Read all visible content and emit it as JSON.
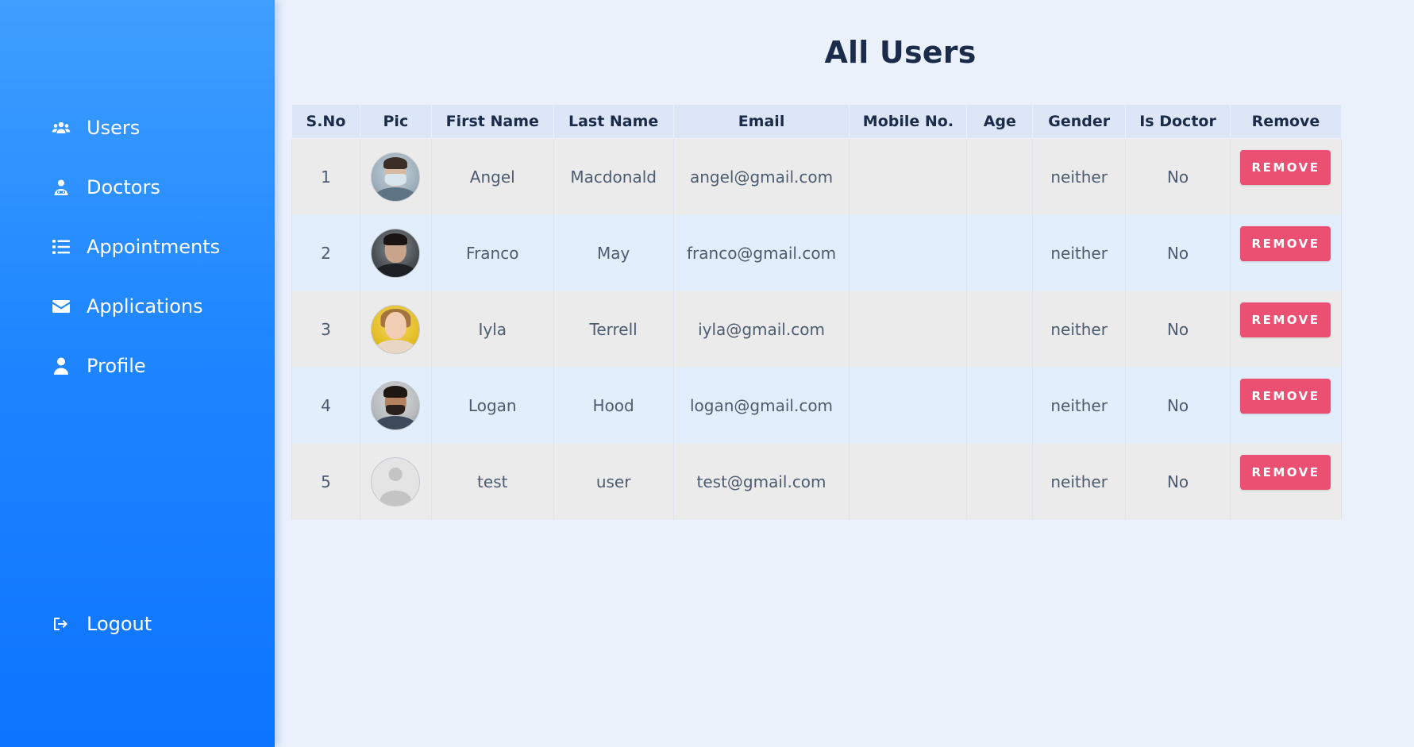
{
  "sidebar": {
    "items": [
      {
        "label": "Users",
        "icon": "users-icon"
      },
      {
        "label": "Doctors",
        "icon": "doctor-icon"
      },
      {
        "label": "Appointments",
        "icon": "list-icon"
      },
      {
        "label": "Applications",
        "icon": "envelope-icon"
      },
      {
        "label": "Profile",
        "icon": "user-icon"
      }
    ],
    "logout": {
      "label": "Logout",
      "icon": "logout-icon"
    }
  },
  "main": {
    "title": "All Users",
    "table": {
      "headers": [
        "S.No",
        "Pic",
        "First Name",
        "Last Name",
        "Email",
        "Mobile No.",
        "Age",
        "Gender",
        "Is Doctor",
        "Remove"
      ],
      "rows": [
        {
          "sno": "1",
          "pic": "avatar-photo",
          "first": "Angel",
          "last": "Macdonald",
          "email": "angel@gmail.com",
          "mobile": "",
          "age": "",
          "gender": "neither",
          "is_doctor": "No",
          "remove": "REMOVE"
        },
        {
          "sno": "2",
          "pic": "avatar-photo",
          "first": "Franco",
          "last": "May",
          "email": "franco@gmail.com",
          "mobile": "",
          "age": "",
          "gender": "neither",
          "is_doctor": "No",
          "remove": "REMOVE"
        },
        {
          "sno": "3",
          "pic": "avatar-photo",
          "first": "Iyla",
          "last": "Terrell",
          "email": "iyla@gmail.com",
          "mobile": "",
          "age": "",
          "gender": "neither",
          "is_doctor": "No",
          "remove": "REMOVE"
        },
        {
          "sno": "4",
          "pic": "avatar-photo",
          "first": "Logan",
          "last": "Hood",
          "email": "logan@gmail.com",
          "mobile": "",
          "age": "",
          "gender": "neither",
          "is_doctor": "No",
          "remove": "REMOVE"
        },
        {
          "sno": "5",
          "pic": "avatar-placeholder",
          "first": "test",
          "last": "user",
          "email": "test@gmail.com",
          "mobile": "",
          "age": "",
          "gender": "neither",
          "is_doctor": "No",
          "remove": "REMOVE"
        }
      ]
    }
  },
  "colors": {
    "sidebar_top": "#3f9fff",
    "sidebar_bottom": "#0c74ff",
    "page_bg": "#eaf1fb",
    "header_bg": "#dde6f7",
    "row_odd": "#ebebeb",
    "row_even": "#e3eefd",
    "remove_button": "#eb4f72",
    "title_text": "#1b2b4a"
  }
}
